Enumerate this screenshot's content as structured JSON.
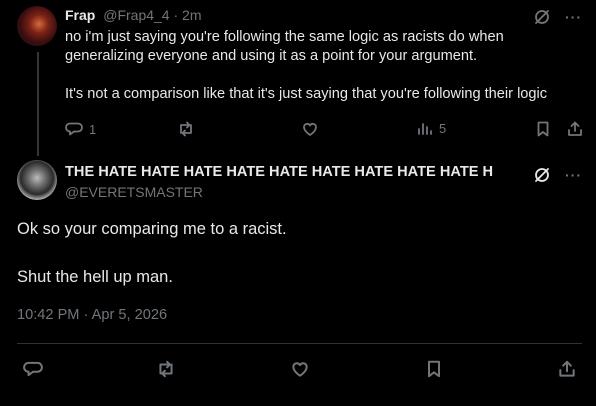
{
  "parent_tweet": {
    "author_name": "Frap",
    "author_handle": "@Frap4_4",
    "separator": "·",
    "time_ago": "2m",
    "text_line_1": "no i'm just saying you're following the same logic as racists do when generalizing everyone and using it as a point for your argument.",
    "text_line_2": "It's not a comparison like that it's just saying that you're following their logic",
    "reply_count": "1",
    "view_count": "5",
    "more_label": "···"
  },
  "main_tweet": {
    "author_name": "THE HATE HATE HATE HATE HATE HATE HATE HATE HATE H",
    "author_handle": "@EVERETSMASTER",
    "text_line_1": "Ok so your comparing me to a racist.",
    "text_line_2": "Shut the hell up man.",
    "timestamp": "10:42 PM · Apr 5, 2026",
    "more_label": "···"
  },
  "colors": {
    "background": "#000000",
    "primary_text": "#e7e9ea",
    "secondary_text": "#71767b",
    "divider": "#2f3336"
  }
}
